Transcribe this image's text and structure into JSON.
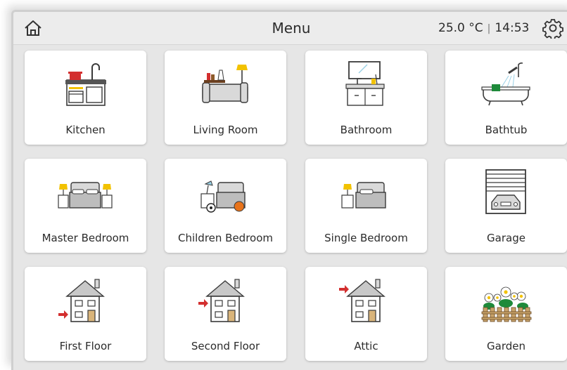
{
  "header": {
    "title": "Menu",
    "temperature": "25.0 °C",
    "separator": "|",
    "time": "14:53",
    "home_icon": "home-icon",
    "settings_icon": "gear-icon"
  },
  "colors": {
    "background": "#e6e6e6",
    "topbar": "#ececec",
    "tile": "#ffffff",
    "icon_stroke": "#3a3a3a",
    "accent_red": "#d32f2f",
    "accent_yellow": "#f2c200",
    "accent_green": "#1e8a3a",
    "accent_orange": "#e8731a"
  },
  "tiles": [
    {
      "label": "Kitchen",
      "icon": "kitchen-icon"
    },
    {
      "label": "Living Room",
      "icon": "living-room-icon"
    },
    {
      "label": "Bathroom",
      "icon": "bathroom-icon"
    },
    {
      "label": "Bathtub",
      "icon": "bathtub-icon"
    },
    {
      "label": "Master Bedroom",
      "icon": "master-bedroom-icon"
    },
    {
      "label": "Children Bedroom",
      "icon": "children-bedroom-icon"
    },
    {
      "label": "Single Bedroom",
      "icon": "single-bedroom-icon"
    },
    {
      "label": "Garage",
      "icon": "garage-icon"
    },
    {
      "label": "First Floor",
      "icon": "first-floor-icon"
    },
    {
      "label": "Second Floor",
      "icon": "second-floor-icon"
    },
    {
      "label": "Attic",
      "icon": "attic-icon"
    },
    {
      "label": "Garden",
      "icon": "garden-icon"
    }
  ]
}
